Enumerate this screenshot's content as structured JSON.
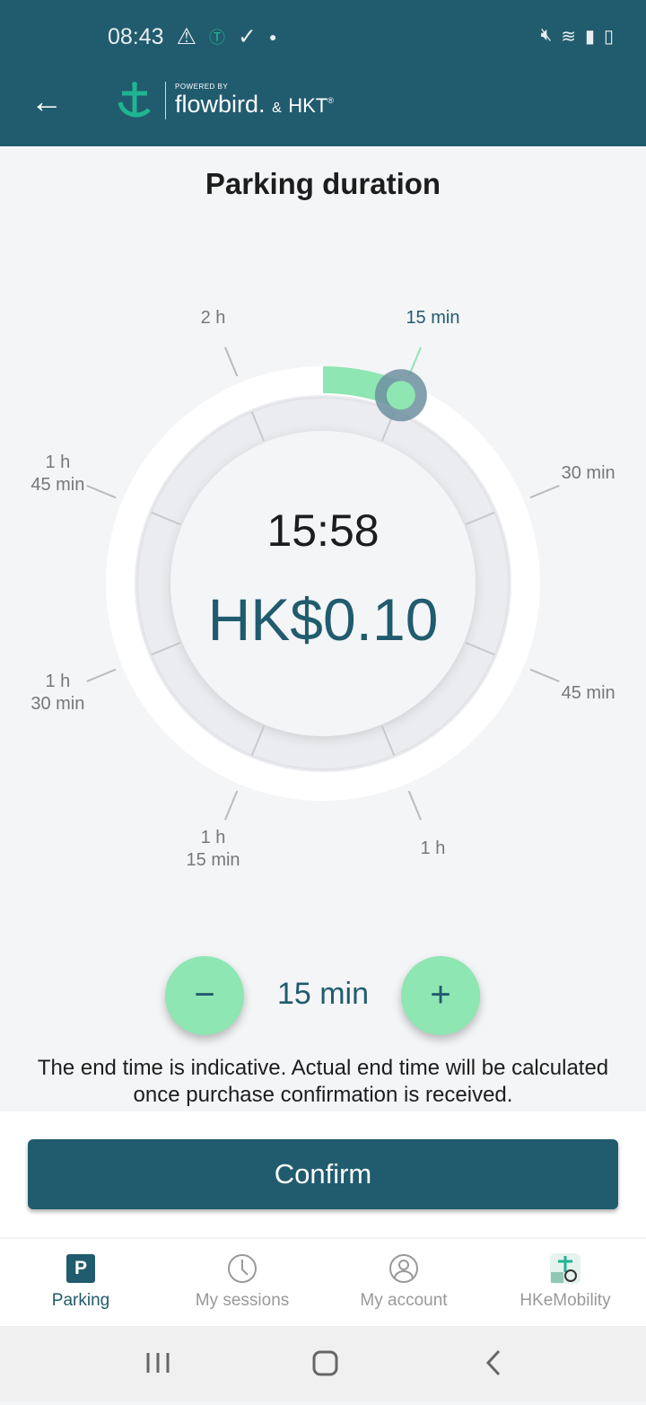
{
  "status_bar": {
    "time": "08:43"
  },
  "header": {
    "powered_by": "POWERED BY",
    "brand": "flowbird.",
    "amp": "&",
    "partner": "HKT",
    "reg": "®"
  },
  "title": "Parking duration",
  "dial": {
    "labels": [
      "15 min",
      "30 min",
      "45 min",
      "1 h",
      "1 h\n15 min",
      "1 h\n30 min",
      "1 h\n45 min",
      "2 h"
    ],
    "selected_fraction": 0.125,
    "max": "2 h",
    "arc_color": "#8ee6b2",
    "handle_color": "#6d8fa0"
  },
  "end_time": "15:58",
  "price": "HK$0.10",
  "stepper": {
    "minus": "−",
    "plus": "+",
    "value": "15 min"
  },
  "note": "The end time is indicative. Actual end time will be calculated once purchase confirmation is received.",
  "confirm": "Confirm",
  "nav": [
    {
      "label": "Parking",
      "icon": "parking-icon"
    },
    {
      "label": "My sessions",
      "icon": "clock-icon"
    },
    {
      "label": "My account",
      "icon": "user-icon"
    },
    {
      "label": "HKeMobility",
      "icon": "hkemobility-icon"
    }
  ],
  "colors": {
    "primary": "#215b6e",
    "accent": "#8ee6b2"
  }
}
